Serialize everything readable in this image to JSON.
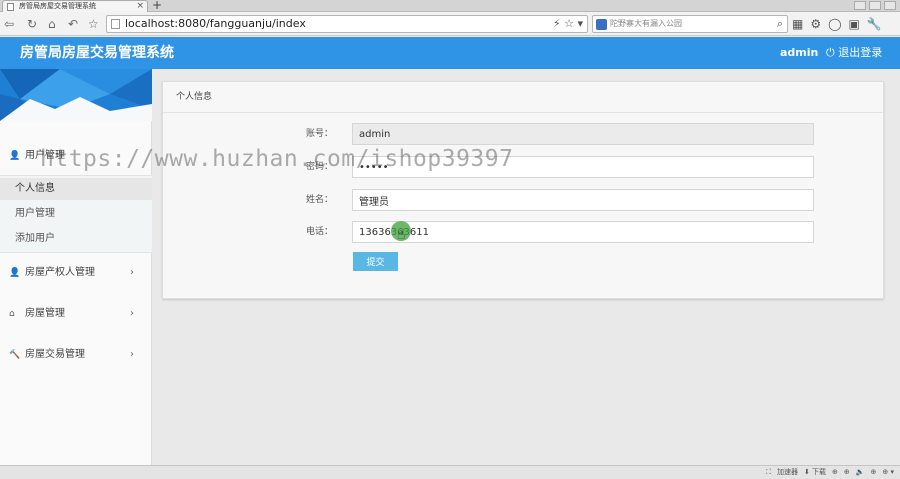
{
  "browser": {
    "tab_title": "房管局房屋交易管理系统",
    "tab_close": "×",
    "new_tab": "+",
    "url": "localhost:8080/fangguanju/index",
    "url_tools": "⚡ ☆ ▾",
    "search_placeholder": "陀野寨大有漏入公园",
    "search_icon": "⌕",
    "nav_icons": [
      "back-icon",
      "refresh-icon",
      "home-icon",
      "undo-icon",
      "star-icon"
    ],
    "nav_glyphs": [
      "⇦",
      "↻",
      "⌂",
      "↶",
      "☆"
    ]
  },
  "header": {
    "title": "房管局房屋交易管理系统",
    "user": "admin",
    "logout": "⏻ 退出登录"
  },
  "sidebar": {
    "groups": [
      {
        "icon": "👤",
        "label": "用户管理",
        "arrow": ""
      },
      {
        "icon": "👤",
        "label": "房屋产权人管理",
        "arrow": "›"
      },
      {
        "icon": "⌂",
        "label": "房屋管理",
        "arrow": "›"
      },
      {
        "icon": "🔨",
        "label": "房屋交易管理",
        "arrow": "›"
      }
    ],
    "sub_items": [
      "个人信息",
      "用户管理",
      "添加用户"
    ]
  },
  "panel": {
    "title": "个人信息",
    "fields": [
      {
        "label": "账号：",
        "value": "admin",
        "type": "text",
        "readonly": true
      },
      {
        "label": "密码：",
        "value": "admin",
        "type": "password",
        "readonly": false
      },
      {
        "label": "姓名：",
        "value": "管理员",
        "type": "text",
        "readonly": false
      },
      {
        "label": "电话：",
        "value": "13636363611",
        "type": "text",
        "readonly": false
      }
    ],
    "submit": "提交"
  },
  "statusbar": {
    "items": [
      "⛶",
      "加速器",
      "⬇ 下载",
      "⊕",
      "⊕",
      "🔈",
      "⊕",
      "⊕ ▾"
    ]
  },
  "watermark": "https://www.huzhan.com/ishop39397"
}
